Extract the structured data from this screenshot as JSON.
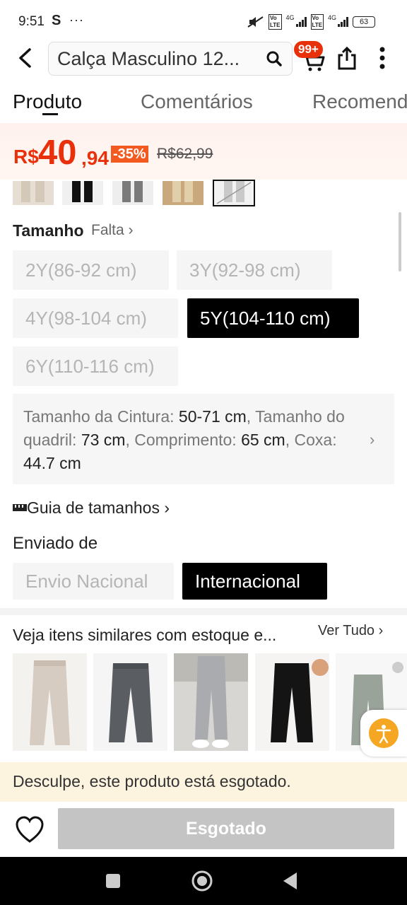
{
  "status_bar": {
    "time": "9:51",
    "carrier_icon": "S",
    "more": "···",
    "net1": "4G",
    "net2": "4G",
    "battery": "63"
  },
  "header": {
    "search_text": "Calça Masculino 12...",
    "cart_badge": "99+"
  },
  "tabs": [
    {
      "label": "Produto"
    },
    {
      "label": "Comentários"
    },
    {
      "label": "Recomend"
    }
  ],
  "price": {
    "currency": "R$",
    "integer": "40",
    "decimal": ",94",
    "discount": "-35%",
    "original": "R$62,99"
  },
  "size": {
    "label": "Tamanho",
    "missing": "Falta",
    "options": [
      {
        "label": "2Y(86-92 cm)",
        "selected": false
      },
      {
        "label": "3Y(92-98 cm)",
        "selected": false
      },
      {
        "label": "4Y(98-104 cm)",
        "selected": false
      },
      {
        "label": "5Y(104-110 cm)",
        "selected": true
      },
      {
        "label": "6Y(110-116 cm)",
        "selected": false
      }
    ],
    "measure": {
      "waist_label": "Tamanho da Cintura: ",
      "waist": "50-71 cm",
      "hip_label": ", Tamanho do quadril: ",
      "hip": "73 cm",
      "length_label": ", Comprimento: ",
      "length": "65 cm",
      "thigh_label": ", Coxa: ",
      "thigh": "44.7 cm"
    },
    "guide": "Guia de tamanhos"
  },
  "shipping": {
    "label": "Enviado de",
    "options": [
      {
        "label": "Envio Nacional",
        "selected": false
      },
      {
        "label": "Internacional",
        "selected": true
      }
    ]
  },
  "similar": {
    "title": "Veja itens similares com estoque e...",
    "see_all": "Ver Tudo"
  },
  "sold_out": {
    "message": "Desculpe, este produto está esgotado.",
    "button": "Esgotado"
  },
  "colors": {
    "accent": "#e8310a",
    "discount_bg": "#f25a1f",
    "sold_out_bg": "#fdf4e0",
    "button_disabled": "#c4c4c4"
  }
}
